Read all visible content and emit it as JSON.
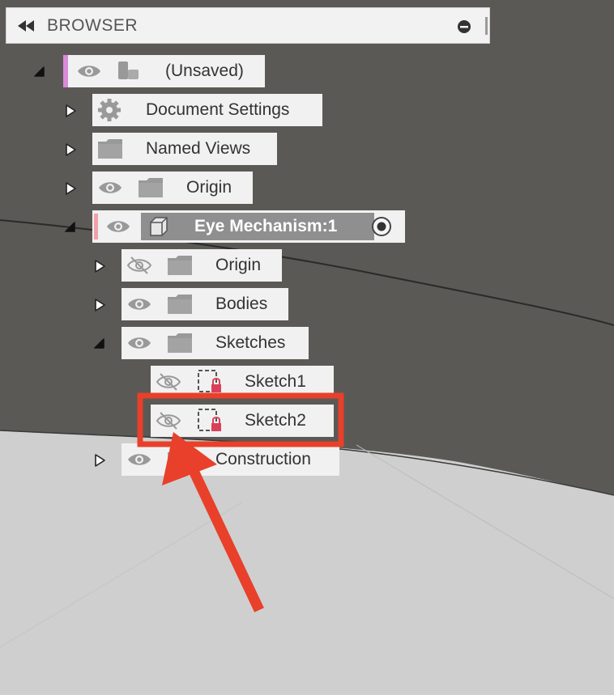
{
  "browser": {
    "title": "BROWSER",
    "items": [
      {
        "label": "(Unsaved)",
        "expanded": true,
        "visible": true,
        "icon": "component-icon"
      },
      {
        "label": "Document Settings",
        "expanded": false,
        "icon": "gear-icon"
      },
      {
        "label": "Named Views",
        "expanded": false,
        "icon": "folder-icon"
      },
      {
        "label": "Origin",
        "expanded": false,
        "visible": true,
        "icon": "folder-icon"
      },
      {
        "label": "Eye Mechanism:1",
        "expanded": true,
        "visible": true,
        "active": true,
        "icon": "component-box-icon"
      },
      {
        "label": "Origin",
        "expanded": false,
        "visible": false,
        "icon": "folder-icon"
      },
      {
        "label": "Bodies",
        "expanded": false,
        "visible": true,
        "icon": "folder-icon"
      },
      {
        "label": "Sketches",
        "expanded": true,
        "visible": true,
        "icon": "folder-icon"
      },
      {
        "label": "Sketch1",
        "visible": false,
        "icon": "sketch-icon"
      },
      {
        "label": "Sketch2",
        "visible": false,
        "icon": "sketch-icon",
        "highlighted": true
      },
      {
        "label": "Construction",
        "expanded": false,
        "visible": true,
        "icon": "folder-icon"
      }
    ]
  },
  "colors": {
    "canvas_dark": "#5b5955",
    "canvas_light": "#d0d0d0",
    "highlight_box": "#e8402a",
    "arrow": "#e8402a",
    "root_accent": "#d98ad8",
    "component_accent": "#f0a0a8",
    "active_row_bg": "#8f8f8f"
  }
}
